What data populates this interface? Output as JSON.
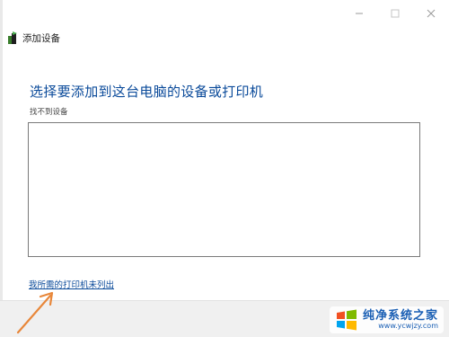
{
  "window": {
    "back_label": "添加设备"
  },
  "main": {
    "title": "选择要添加到这台电脑的设备或打印机",
    "status": "找不到设备",
    "printer_link": "我所需的打印机未列出"
  },
  "watermark": {
    "title": "纯净系统之家",
    "url": "www.ycwjzy.com"
  },
  "colors": {
    "link_blue": "#0a4a9a",
    "footer_bg": "#f0f0f0",
    "arrow": "#e8873a",
    "watermark_blue": "#1a5fb4"
  },
  "icons": {
    "back": "wizard-back-icon",
    "minimize": "minimize-icon",
    "maximize": "maximize-icon",
    "close": "close-icon",
    "annotation": "arrow-annotation",
    "watermark_logo": "windows-logo-icon"
  }
}
